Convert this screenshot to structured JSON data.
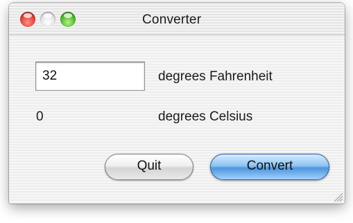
{
  "window": {
    "title": "Converter",
    "traffic_lights": [
      "close",
      "minimize",
      "zoom"
    ]
  },
  "form": {
    "fahrenheit_value": "32",
    "fahrenheit_label": "degrees Fahrenheit",
    "celsius_value": "0",
    "celsius_label": "degrees Celsius"
  },
  "buttons": {
    "quit_label": "Quit",
    "convert_label": "Convert"
  },
  "colors": {
    "close": "#e0443a",
    "minimize": "#e4e4e4",
    "zoom": "#4cbb2a",
    "default_button": "#4f95de"
  }
}
